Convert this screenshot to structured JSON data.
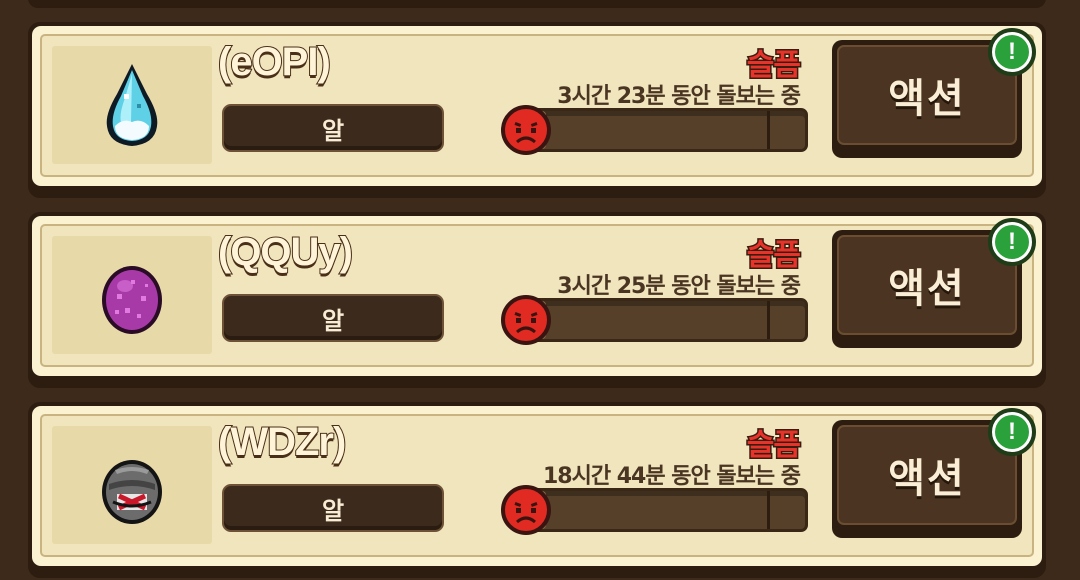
{
  "pets": [
    {
      "name": "(eOPI)",
      "stage": "알",
      "mood": "슬픔",
      "care_time": "3시간 23분 동안 돌보는 중",
      "action_label": "액션",
      "alert": "!",
      "gauge_level": 0.1,
      "icon": "blue-ice-egg-icon",
      "mood_icon": "sad-face-icon"
    },
    {
      "name": "(QQUy)",
      "stage": "알",
      "mood": "슬픔",
      "care_time": "3시간 25분 동안 돌보는 중",
      "action_label": "액션",
      "alert": "!",
      "gauge_level": 0.1,
      "icon": "purple-spotted-egg-icon",
      "mood_icon": "sad-face-icon"
    },
    {
      "name": "(WDZr)",
      "stage": "알",
      "mood": "슬픔",
      "care_time": "18시간 44분 동안 돌보는 중",
      "action_label": "액션",
      "alert": "!",
      "gauge_level": 0.1,
      "icon": "striped-gray-egg-icon",
      "mood_icon": "sad-face-icon"
    }
  ],
  "colors": {
    "background": "#3d2a1a",
    "card": "#f0e5bd",
    "mood_sad": "#e8332b",
    "alert_green": "#2aa13a"
  }
}
